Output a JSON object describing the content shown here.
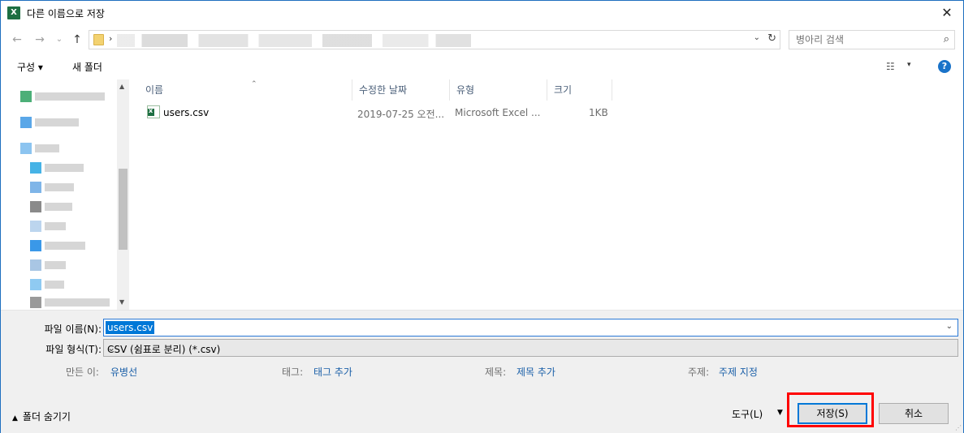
{
  "window": {
    "title": "다른 이름으로 저장",
    "app_icon_letter": "X",
    "close_symbol": "✕"
  },
  "nav": {
    "back_symbol": "←",
    "forward_symbol": "→",
    "recent_symbol": "⌄",
    "up_symbol": "↑",
    "crumb_separator": "›",
    "address_dropdown_symbol": "⌄",
    "refresh_symbol": "↻",
    "search_placeholder": "병아리 검색",
    "search_icon_symbol": "⌕"
  },
  "toolbar": {
    "organize_label": "구성 ▾",
    "new_folder_label": "새 폴더",
    "view_symbol": "☷",
    "view_caret": "▾",
    "help_symbol": "?"
  },
  "columns": {
    "name": "이름",
    "modified": "수정한 날짜",
    "type": "유형",
    "size": "크기",
    "sort_symbol": "⌃"
  },
  "files": [
    {
      "name": "users.csv",
      "modified": "2019-07-25 오전...",
      "type": "Microsoft Excel ...",
      "size": "1KB"
    }
  ],
  "form": {
    "filename_label": "파일 이름(N):",
    "filename_value": "users.csv",
    "filetype_label": "파일 형식(T):",
    "filetype_value": "CSV (쉼표로 분리) (*.csv)",
    "dropdown_symbol": "⌄"
  },
  "metadata": {
    "authors_label": "만든 이:",
    "authors_value": "유병선",
    "tags_label": "태그:",
    "tags_value": "태그 추가",
    "title_label": "제목:",
    "title_value": "제목 추가",
    "subject_label": "주제:",
    "subject_value": "주제 지정"
  },
  "footer": {
    "hide_folders_label": "폴더 숨기기",
    "hide_folders_symbol": "▲",
    "tools_label": "도구(L)",
    "tools_caret": "▼",
    "save_label": "저장(S)",
    "cancel_label": "취소"
  },
  "colors": {
    "accent": "#0078d7",
    "highlight": "#ff0000",
    "excel_green": "#1d6f42",
    "link": "#1a5fa8"
  }
}
